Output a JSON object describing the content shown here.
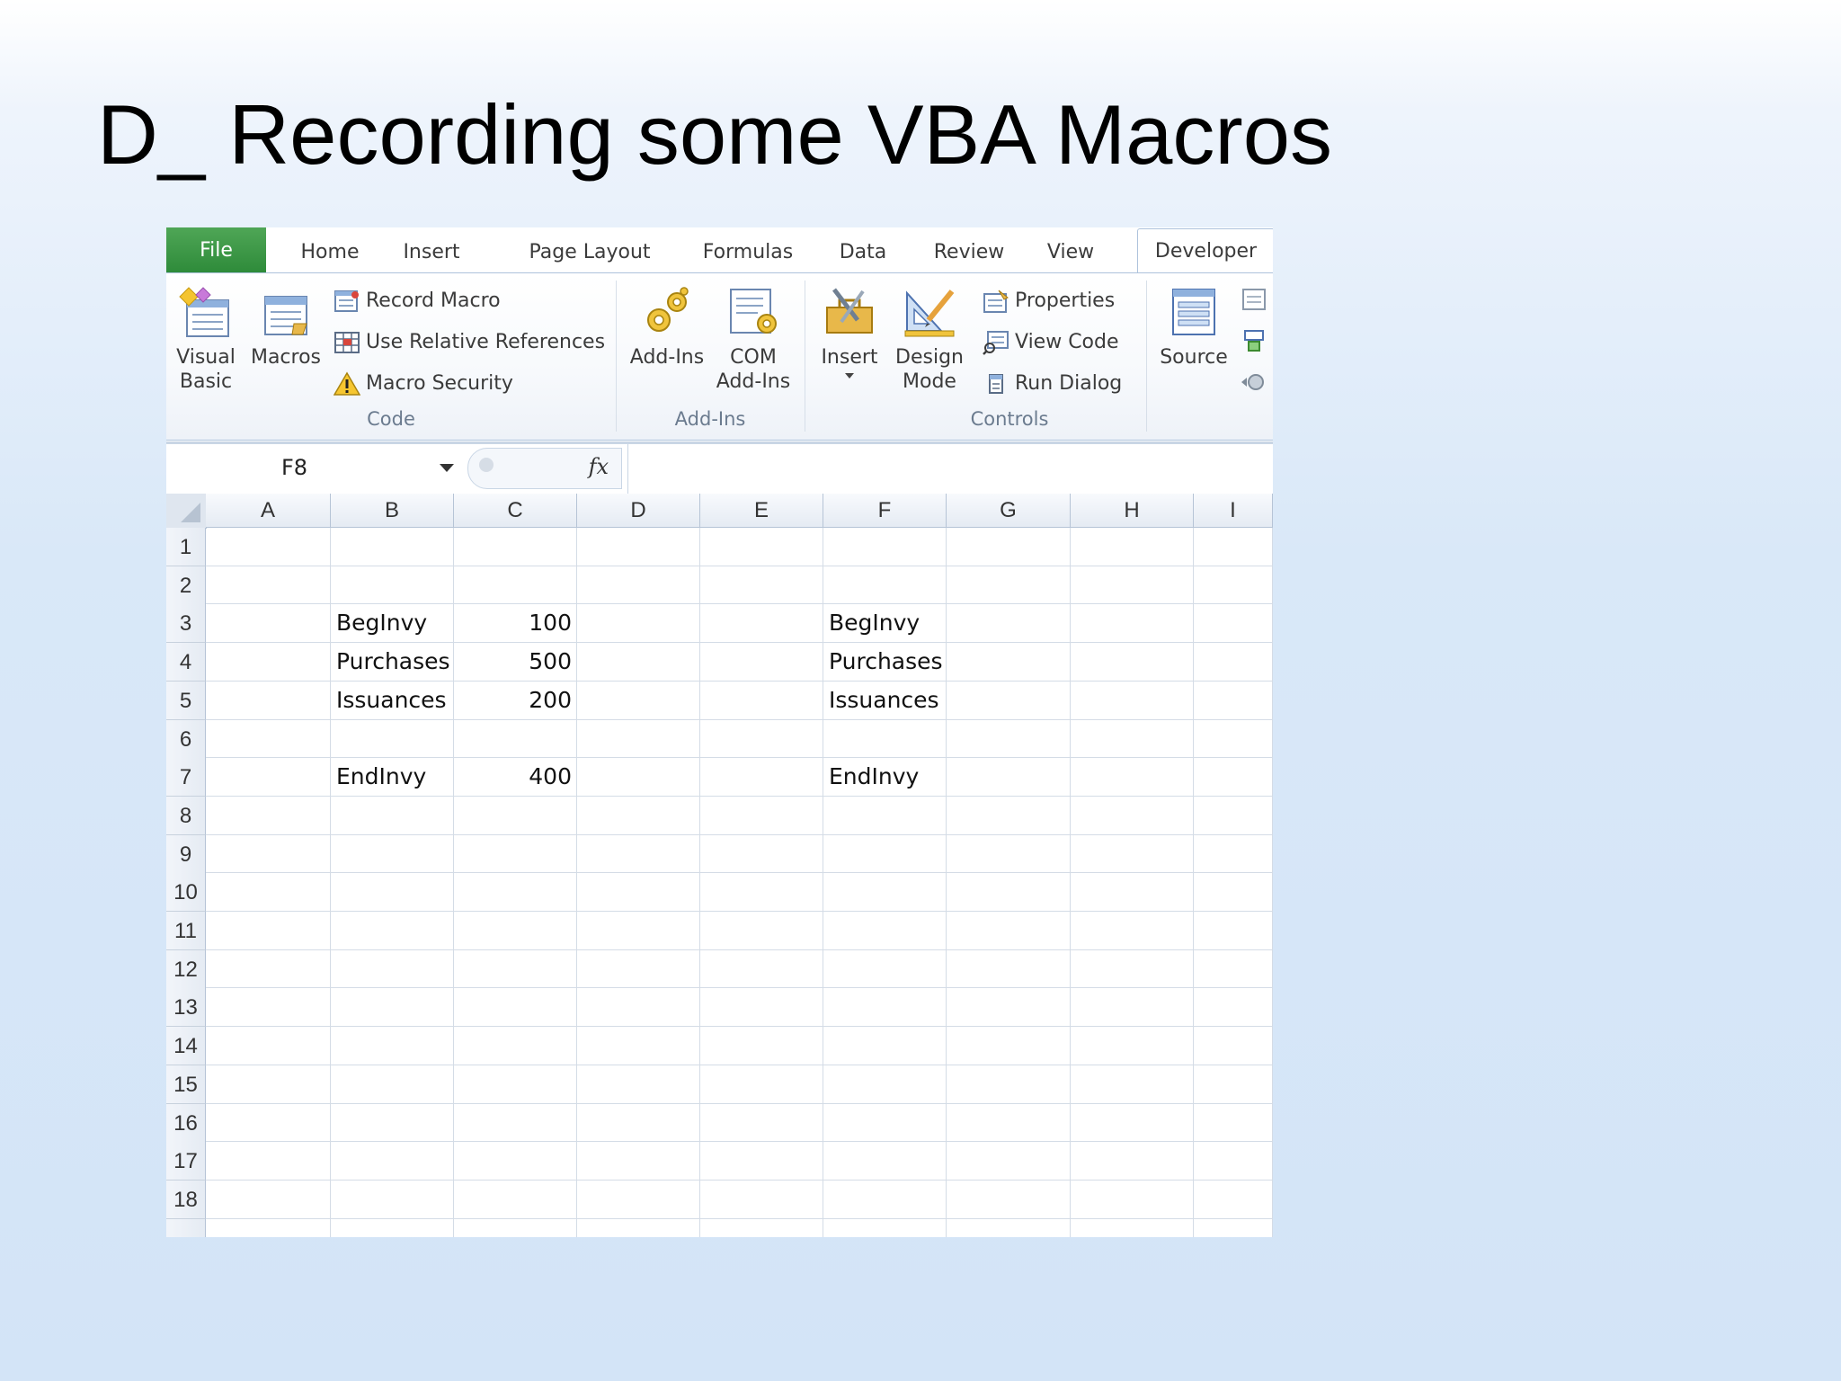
{
  "slide": {
    "title": "D_ Recording some VBA Macros"
  },
  "tabs": [
    "File",
    "Home",
    "Insert",
    "Page Layout",
    "Formulas",
    "Data",
    "Review",
    "View",
    "Developer"
  ],
  "ribbon": {
    "code": {
      "visual_basic": [
        "Visual",
        "Basic"
      ],
      "macros": "Macros",
      "record_macro": "Record Macro",
      "use_relative": "Use Relative References",
      "macro_security": "Macro Security",
      "label": "Code"
    },
    "addins": {
      "addins": "Add-Ins",
      "com_addins": [
        "COM",
        "Add-Ins"
      ],
      "label": "Add-Ins"
    },
    "controls": {
      "insert": "Insert",
      "design_mode": [
        "Design",
        "Mode"
      ],
      "properties": "Properties",
      "view_code": "View Code",
      "run_dialog": "Run Dialog",
      "label": "Controls"
    },
    "xml": {
      "source": "Source"
    }
  },
  "formula_bar": {
    "name_box": "F8",
    "fx": "fx",
    "formula": ""
  },
  "columns": [
    "A",
    "B",
    "C",
    "D",
    "E",
    "F",
    "G",
    "H",
    "I"
  ],
  "rows": [
    "1",
    "2",
    "3",
    "4",
    "5",
    "6",
    "7",
    "8",
    "9",
    "10",
    "11",
    "12",
    "13",
    "14",
    "15",
    "16",
    "17",
    "18"
  ],
  "cells": {
    "B3": "BegInvy",
    "C3": "100",
    "F3": "BegInvy",
    "B4": "Purchases",
    "C4": "500",
    "F4": "Purchases",
    "B5": "Issuances",
    "C5": "200",
    "F5": "Issuances",
    "B7": "EndInvy",
    "C7": "400",
    "F7": "EndInvy"
  }
}
